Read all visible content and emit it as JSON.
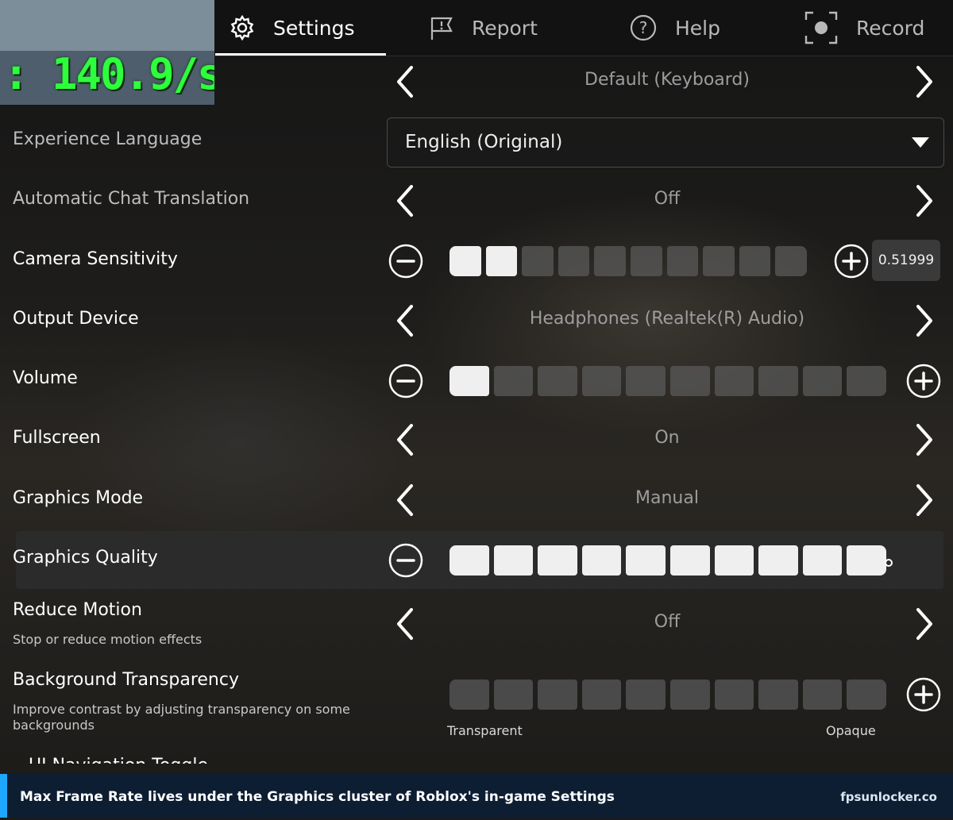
{
  "fps_overlay": {
    "text": ": 140.9/s"
  },
  "tabs": [
    {
      "label": "Settings",
      "icon": "gear-icon",
      "active": true
    },
    {
      "label": "Report",
      "icon": "flag-icon",
      "active": false
    },
    {
      "label": "Help",
      "icon": "help-icon",
      "active": false
    },
    {
      "label": "Record",
      "icon": "record-icon",
      "active": false
    }
  ],
  "settings": {
    "movement_mode": {
      "value": "Default (Keyboard)"
    },
    "experience_language": {
      "label": "Experience Language",
      "value": "English (Original)"
    },
    "chat_translation": {
      "label": "Automatic Chat Translation",
      "value": "Off"
    },
    "camera_sensitivity": {
      "label": "Camera Sensitivity",
      "readout": "0.51999",
      "level": 2,
      "max": 10
    },
    "output_device": {
      "label": "Output Device",
      "value": "Headphones (Realtek(R) Audio)"
    },
    "volume": {
      "label": "Volume",
      "level": 1,
      "max": 10
    },
    "fullscreen": {
      "label": "Fullscreen",
      "value": "On"
    },
    "graphics_mode": {
      "label": "Graphics Mode",
      "value": "Manual"
    },
    "graphics_quality": {
      "label": "Graphics Quality",
      "level": 10,
      "max": 10
    },
    "reduce_motion": {
      "label": "Reduce Motion",
      "description": "Stop or reduce motion effects",
      "value": "Off"
    },
    "background_transparency": {
      "label": "Background Transparency",
      "description": "Improve contrast by adjusting transparency on some backgrounds",
      "level": 0,
      "max": 10,
      "min_label": "Transparent",
      "max_label": "Opaque"
    },
    "next_label_partial": "UI Navigation Toggle"
  },
  "footer": {
    "caption": "Max Frame Rate lives under the Graphics cluster of Roblox's in-game Settings",
    "site": "fpsunlocker.co"
  },
  "colors": {
    "accent": "#1ea7ff",
    "footer_bg": "#0d1e33",
    "fps_green": "#2dff3c"
  }
}
